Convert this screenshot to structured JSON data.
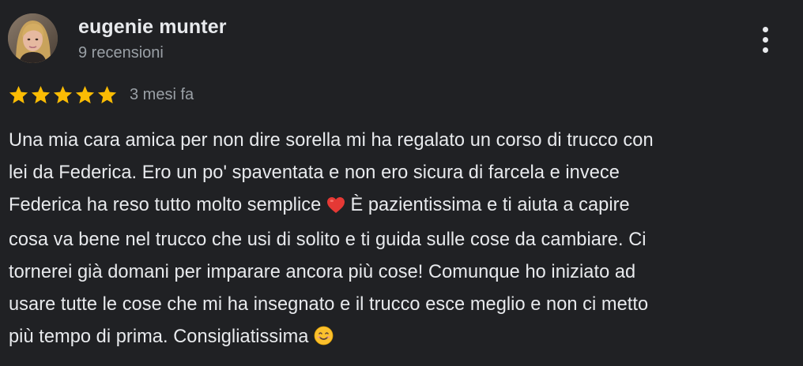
{
  "review": {
    "author_name": "eugenie munter",
    "review_count": "9 recensioni",
    "rating": 5,
    "rating_max": 5,
    "date": "3 mesi fa",
    "text_lines": [
      "Una mia cara amica per non dire sorella mi ha regalato un corso di trucco con",
      "lei da Federica. Ero un po' spaventata e non ero sicura di farcela e invece",
      "Federica ha reso tutto molto semplice",
      "È pazientissima e ti aiuta a capire",
      "cosa va bene nel trucco che usi di solito e ti guida sulle cose da cambiare. Ci",
      "tornerei già domani per imparare ancora più cose! Comunque ho iniziato ad",
      "usare tutte le cose che mi ha insegnato e il trucco esce meglio e non ci metto",
      "più tempo di prima. Consigliatissima"
    ],
    "emojis": [
      "red-heart-icon",
      "smiling-face-icon"
    ],
    "icons": {
      "more_menu": "more-vertical-icon",
      "star": "star-icon"
    }
  },
  "colors": {
    "background": "#202124",
    "text_primary": "#e8eaed",
    "text_secondary": "#9aa0a6",
    "star": "#fbbc04",
    "heart": "#e53935",
    "smiley": "#fbc02d"
  }
}
